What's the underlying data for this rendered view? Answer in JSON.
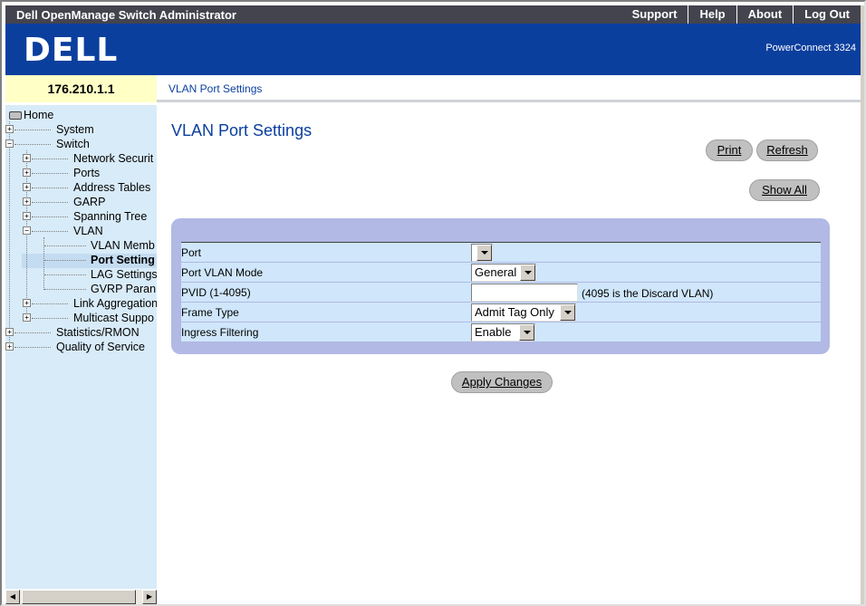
{
  "topbar": {
    "title": "Dell OpenManage Switch Administrator",
    "links": [
      "Support",
      "Help",
      "About",
      "Log Out"
    ]
  },
  "banner": {
    "logo": "DELL",
    "product": "PowerConnect 3324"
  },
  "ip": "176.210.1.1",
  "breadcrumb": "VLAN Port Settings",
  "tree": [
    {
      "label": "Home",
      "icon": "computer-icon"
    },
    {
      "label": "System"
    },
    {
      "label": "Switch"
    },
    {
      "label": "Network Securit"
    },
    {
      "label": "Ports"
    },
    {
      "label": "Address Tables"
    },
    {
      "label": "GARP"
    },
    {
      "label": "Spanning Tree"
    },
    {
      "label": "VLAN"
    },
    {
      "label": "VLAN Memb"
    },
    {
      "label": "Port Setting",
      "selected": true
    },
    {
      "label": "LAG Settings"
    },
    {
      "label": "GVRP Paran"
    },
    {
      "label": "Link Aggregation"
    },
    {
      "label": "Multicast Suppo"
    },
    {
      "label": "Statistics/RMON"
    },
    {
      "label": "Quality of Service"
    }
  ],
  "main": {
    "title": "VLAN Port Settings",
    "buttons": {
      "print": "Print",
      "refresh": "Refresh",
      "show_all": "Show All",
      "apply": "Apply Changes"
    },
    "form": {
      "port": {
        "label": "Port",
        "value": ""
      },
      "port_vlan_mode": {
        "label": "Port VLAN Mode",
        "value": "General"
      },
      "pvid": {
        "label": "PVID (1-4095)",
        "value": "",
        "hint": "(4095 is the Discard VLAN)"
      },
      "frame_type": {
        "label": "Frame Type",
        "value": "Admit Tag Only"
      },
      "ingress_filtering": {
        "label": "Ingress Filtering",
        "value": "Enable"
      }
    }
  },
  "colors": {
    "topbar": "#44444e",
    "banner": "#0b3f9e",
    "ip_bg": "#ffffc6",
    "tree_bg": "#d8ebf8",
    "panel": "#b1b9e4",
    "row": "#cfe6fb",
    "heading": "#0b3f9e"
  }
}
